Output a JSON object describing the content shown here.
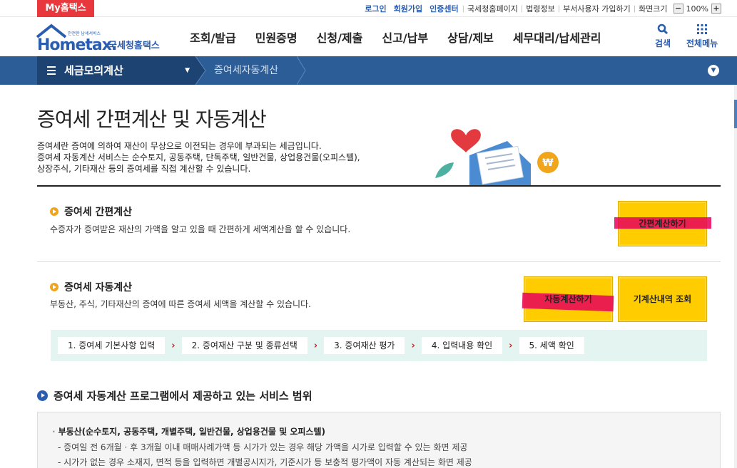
{
  "topbar": {
    "my_hometax": "My홈택스",
    "links": [
      "로그인",
      "회원가입",
      "인증센터"
    ],
    "plain_links": [
      "국세청홈페이지",
      "법령정보",
      "부서사용자 가입하기",
      "화면크기"
    ],
    "zoom": {
      "minus": "−",
      "value": "100%",
      "plus": "+"
    }
  },
  "logo": {
    "small": "안전한 납세서비스",
    "brand": "Hometax.",
    "korean": "국세청홈택스"
  },
  "gnb": [
    "조회/발급",
    "민원증명",
    "신청/제출",
    "신고/납부",
    "상담/제보",
    "세무대리/납세관리"
  ],
  "header_icons": {
    "search": "검색",
    "all_menu": "전체메뉴"
  },
  "location": {
    "level1": "세금모의계산",
    "level2": "증여세자동계산"
  },
  "page": {
    "title": "증여세 간편계산 및 자동계산",
    "desc": [
      "증여세란 증여에 의하여 재산이 무상으로 이전되는 경우에 부과되는 세금입니다.",
      "증여세 자동계산 서비스는 순수토지, 공동주택, 단독주택, 일반건물, 상업용건물(오피스텔),",
      "상장주식, 기타재산 등의 증여세를 직접 계산할 수 있습니다."
    ]
  },
  "simple": {
    "title": "증여세 간편계산",
    "desc": "수증자가 증여받은 재산의 가액을 알고 있을 때 간편하게 세액계산을 할 수 있습니다.",
    "button": "간편계산하기"
  },
  "auto": {
    "title": "증여세 자동계산",
    "desc": "부동산, 주식, 기타재산의 증여에 따른 증여세 세액을 계산할 수 있습니다.",
    "button": "자동계산하기",
    "history_button": "기계산내역 조회",
    "steps": [
      "1. 증여세 기본사항 입력",
      "2. 증여재산 구분 및 종류선택",
      "3. 증여재산 평가",
      "4. 입력내용 확인",
      "5. 세액 확인"
    ]
  },
  "services": {
    "title": "증여세 자동계산 프로그램에서 제공하고 있는 서비스 범위",
    "heading": "부동산(순수토지, 공동주택, 개별주택, 일반건물, 상업용건물 및 오피스텔)",
    "items": [
      "- 증여일 전 6개월 · 후 3개월 이내 매매사례가액 등 시가가 있는 경우 해당 가액을 시가로 입력할 수 있는 화면 제공",
      "- 시가가 없는 경우 소재지, 면적 등을 입력하면 개별공시지가, 기준시가 등 보충적 평가액이 자동 계산되는 화면 제공"
    ]
  },
  "colors": {
    "brand_blue": "#2c5d97",
    "yellow_button": "#ffcc00",
    "highlight_mark": "#e8005a",
    "my_hometax_red": "#e8383d"
  }
}
